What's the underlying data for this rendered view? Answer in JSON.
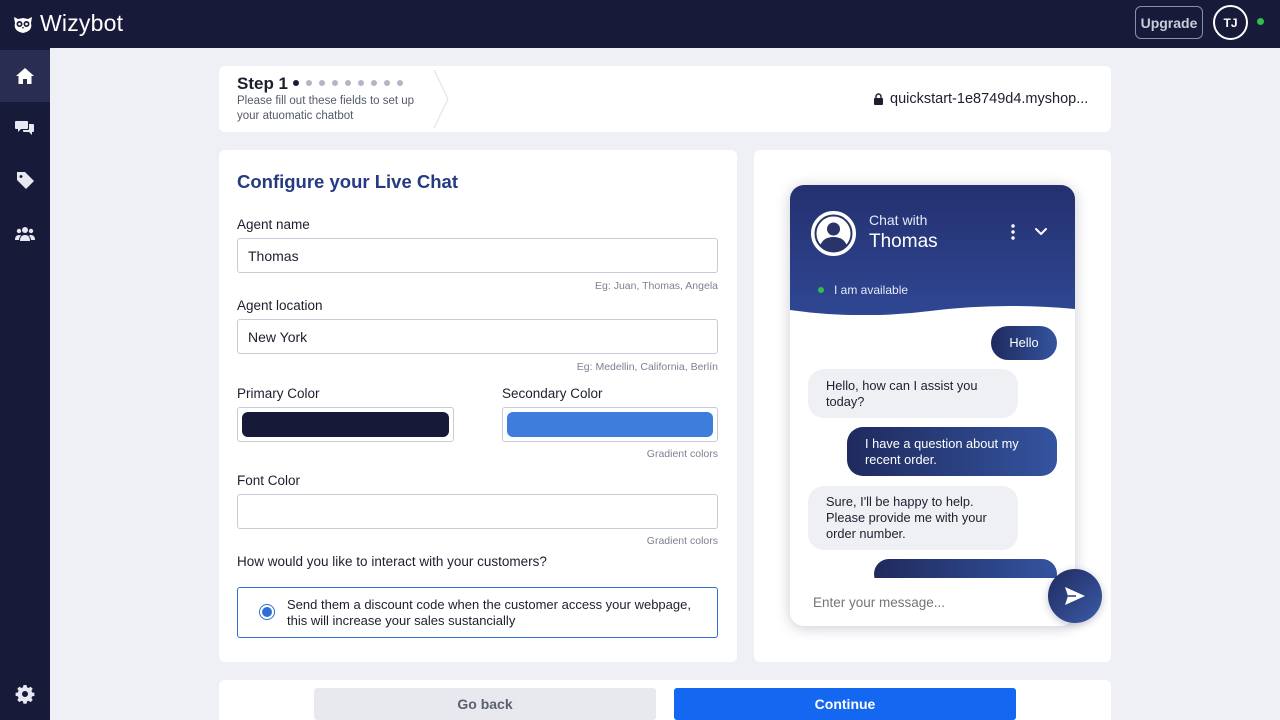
{
  "app": {
    "logo_text": "Wizybot",
    "upgrade_label": "Upgrade",
    "user_initials": "TJ"
  },
  "sidebar": {
    "items": [
      {
        "name": "home",
        "icon": "home-icon"
      },
      {
        "name": "conversations",
        "icon": "chat-bubbles-icon"
      },
      {
        "name": "tags",
        "icon": "tag-icon"
      },
      {
        "name": "team",
        "icon": "users-icon"
      }
    ],
    "bottom_icon": "gear-icon"
  },
  "step": {
    "title": "Step 1",
    "current": 1,
    "total": 9,
    "description": "Please fill out these fields to set up your atuomatic chatbot",
    "shop_url": "quickstart-1e8749d4.myshop..."
  },
  "form": {
    "title": "Configure your Live Chat",
    "agent_name_label": "Agent name",
    "agent_name_value": "Thomas",
    "agent_name_hint": "Eg: Juan, Thomas, Angela",
    "agent_location_label": "Agent location",
    "agent_location_value": "New York",
    "agent_location_hint": "Eg: Medellin, California, Berlín",
    "primary_color_label": "Primary Color",
    "primary_color": "#161a38",
    "secondary_color_label": "Secondary Color",
    "secondary_color": "#3e7ddc",
    "gradient_hint_1": "Gradient colors",
    "font_color_label": "Font Color",
    "font_color": "#ffffff",
    "gradient_hint_2": "Gradient colors",
    "interaction_question": "How would you like to interact with your customers?",
    "interaction_option": "Send them a discount code when the customer access your webpage, this will increase your sales sustancially"
  },
  "chat": {
    "chat_with_label": "Chat with",
    "agent_name": "Thomas",
    "availability": "I am available",
    "messages": [
      {
        "from": "user",
        "text": "Hello"
      },
      {
        "from": "agent",
        "text": "Hello, how can I assist you today?"
      },
      {
        "from": "user",
        "text": "I have a question about my recent order."
      },
      {
        "from": "agent",
        "text": "Sure, I'll be happy to help. Please provide me with your order number."
      }
    ],
    "input_placeholder": "Enter your message..."
  },
  "footer": {
    "back_label": "Go back",
    "continue_label": "Continue"
  },
  "colors": {
    "nav_bg": "#181a3a",
    "accent": "#1467f0",
    "title_blue": "#243a82",
    "online_green": "#2fbf4b"
  }
}
